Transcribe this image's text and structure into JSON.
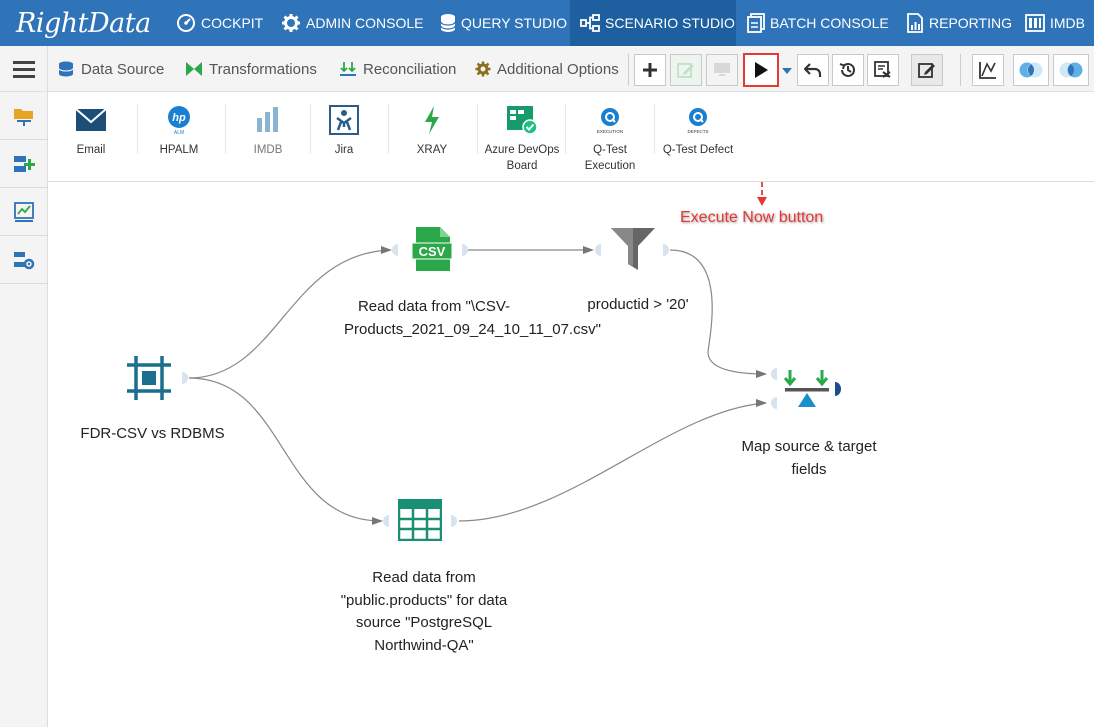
{
  "brand": {
    "logo_text": "RightData"
  },
  "topnav": {
    "items": [
      {
        "label": "COCKPIT",
        "icon": "cockpit-icon"
      },
      {
        "label": "ADMIN CONSOLE",
        "icon": "gear-icon"
      },
      {
        "label": "QUERY STUDIO",
        "icon": "database-icon"
      },
      {
        "label": "SCENARIO STUDIO",
        "icon": "scenario-icon",
        "active": true
      },
      {
        "label": "BATCH CONSOLE",
        "icon": "batch-icon"
      },
      {
        "label": "REPORTING",
        "icon": "report-icon"
      },
      {
        "label": "IMDB",
        "icon": "imdb-icon"
      }
    ]
  },
  "toolbar": {
    "tabs": [
      {
        "label": "Data Source",
        "icon": "database-icon"
      },
      {
        "label": "Transformations",
        "icon": "transform-icon"
      },
      {
        "label": "Reconciliation",
        "icon": "reconcile-icon"
      },
      {
        "label": "Additional Options",
        "icon": "gear-icon"
      }
    ],
    "buttons": [
      "add-icon",
      "edit-icon",
      "monitor-icon",
      "execute-now-icon",
      "undo-icon",
      "history-icon",
      "export-icon",
      "notes-icon",
      "chart-icon",
      "venn-left-icon",
      "venn-right-icon"
    ]
  },
  "integrations": [
    {
      "label": "Email"
    },
    {
      "label": "HPALM"
    },
    {
      "label": "IMDB"
    },
    {
      "label": "Jira"
    },
    {
      "label": "XRAY"
    },
    {
      "label": "Azure DevOps Board"
    },
    {
      "label": "Q-Test Execution"
    },
    {
      "label": "Q-Test Defect"
    }
  ],
  "nodes": {
    "start": {
      "label": "FDR-CSV vs RDBMS"
    },
    "csv": {
      "label": "Read data from \"\\CSV-Products_2021_09_24_10_11_07.csv\""
    },
    "filter": {
      "label": "productid > '20'"
    },
    "table": {
      "label": "Read data from \"public.products\" for data source \"PostgreSQL Northwind-QA\""
    },
    "map": {
      "label": "Map source & target fields"
    }
  },
  "annotation": {
    "text": "Execute Now button"
  },
  "colors": {
    "nav": "#2f73b8",
    "nav_active": "#1d5f9f",
    "annotation": "#e53935",
    "node_teal": "#1a6f8c"
  }
}
